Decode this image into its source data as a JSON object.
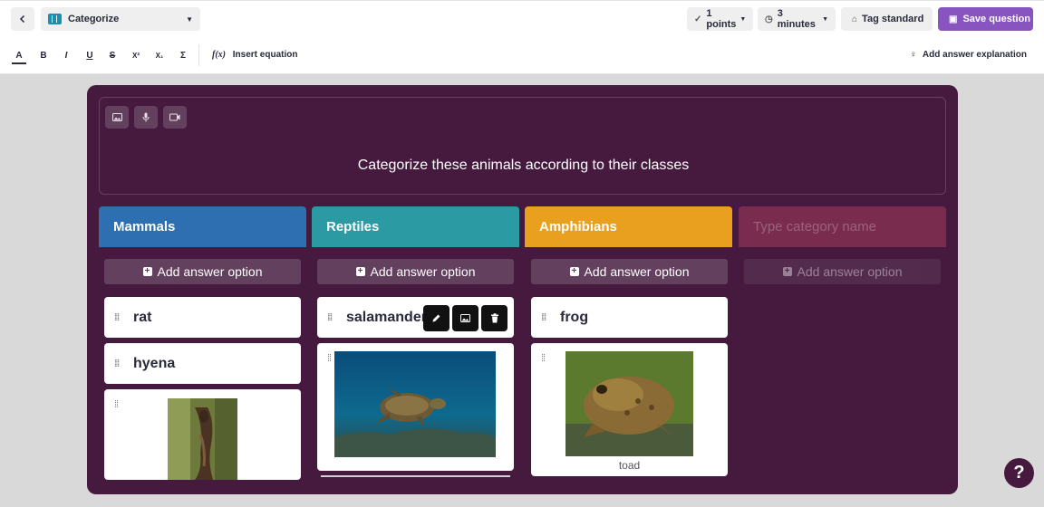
{
  "header": {
    "question_type": "Categorize",
    "points": "1 points",
    "time": "3 minutes",
    "tag_label": "Tag standard",
    "save_label": "Save question"
  },
  "toolbar": {
    "formats": [
      "A",
      "B",
      "I",
      "U",
      "S",
      "X²",
      "X₁",
      "Σ"
    ],
    "insert_equation": "Insert equation",
    "add_explanation": "Add answer explanation"
  },
  "question": {
    "text": "Categorize these animals according to their classes",
    "media_buttons": [
      "image-icon",
      "microphone-icon",
      "video-icon"
    ]
  },
  "categories": [
    {
      "name": "Mammals",
      "color": "#2d6fb1",
      "placeholder": false
    },
    {
      "name": "Reptiles",
      "color": "#2b9aa3",
      "placeholder": false
    },
    {
      "name": "Amphibians",
      "color": "#e9a01e",
      "placeholder": false
    },
    {
      "name": "Type category name",
      "color": "#7a2c4e",
      "placeholder": true
    }
  ],
  "add_option_label": "Add answer option",
  "options": {
    "mammals": [
      "rat",
      "hyena"
    ],
    "reptiles": [
      "salamander"
    ],
    "amphibians": [
      "frog"
    ]
  },
  "image_captions": {
    "toad": "toad"
  },
  "help_label": "?"
}
